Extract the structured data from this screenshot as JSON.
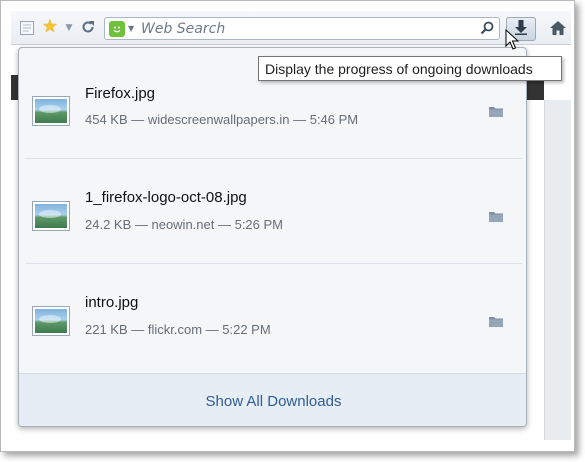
{
  "toolbar": {
    "search": {
      "placeholder": "Web Search",
      "value": ""
    },
    "icons": {
      "page": "page-icon",
      "bookmark": "star-icon",
      "reload": "reload-icon",
      "search_engine": "search-engine-icon",
      "magnifier": "magnifier-icon",
      "downloads": "download-arrow-icon",
      "home": "home-icon"
    }
  },
  "tooltip": {
    "text": "Display the progress of ongoing downloads"
  },
  "downloads": {
    "items": [
      {
        "filename": "Firefox.jpg",
        "info": "454 KB — widescreenwallpapers.in — 5:46 PM"
      },
      {
        "filename": "1_firefox-logo-oct-08.jpg",
        "info": "24.2 KB — neowin.net — 5:26 PM"
      },
      {
        "filename": "intro.jpg",
        "info": "221 KB — flickr.com — 5:22 PM"
      }
    ],
    "show_all_label": "Show All Downloads"
  },
  "colors": {
    "link": "#2e5d96",
    "star": "#f4c430",
    "search_engine": "#6fc13c"
  }
}
